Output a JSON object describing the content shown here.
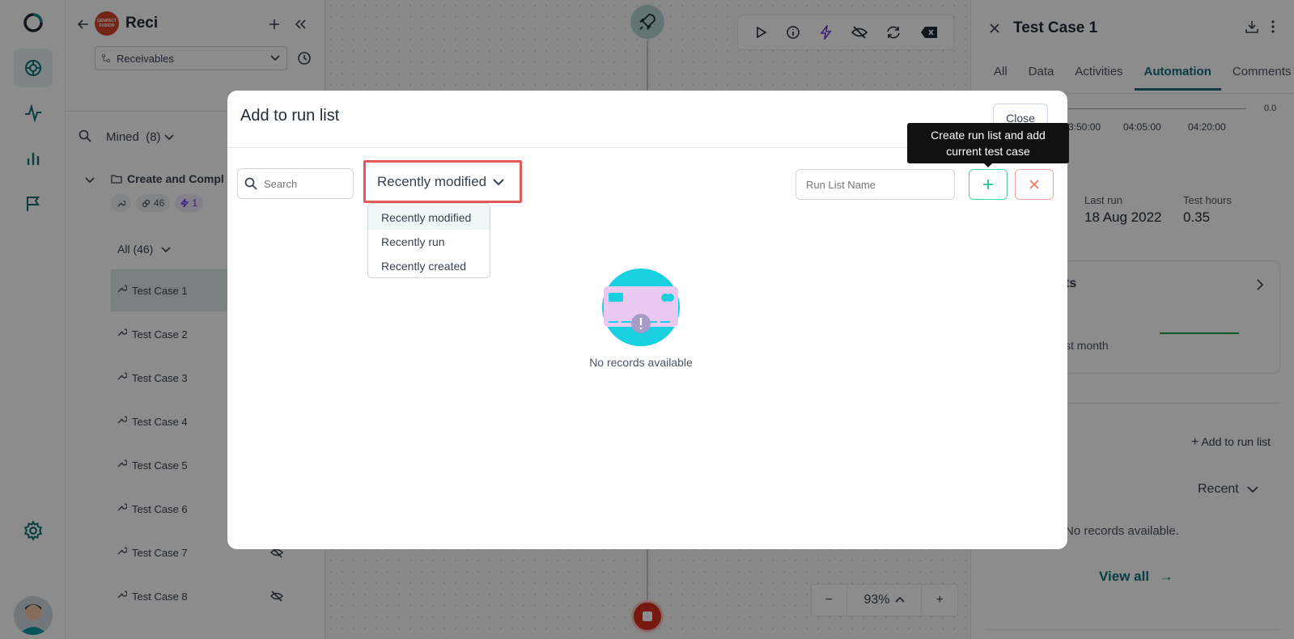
{
  "sidebar": {
    "project_title": "Reci",
    "logo_text": "GENPACT FUSION",
    "project_select": "Receivables",
    "mined_label": "Mined",
    "mined_count": "(8)",
    "folder_name": "Create and Compl",
    "chip_links": "46",
    "chip_auto": "1",
    "all_label": "All (46)",
    "test_cases": [
      "Test Case 1",
      "Test Case 2",
      "Test Case 3",
      "Test Case 4",
      "Test Case 5",
      "Test Case 6",
      "Test Case 7",
      "Test Case 8"
    ]
  },
  "canvas": {
    "zoom_level": "93%",
    "zoom_minus": "−",
    "zoom_plus": "+"
  },
  "right_panel": {
    "title": "Test Case 1",
    "tabs": [
      "All",
      "Data",
      "Activities",
      "Automation",
      "Comments"
    ],
    "active_tab": "Automation",
    "timeline_ticks": [
      "3:50:00",
      "04:05:00",
      "04:20:00"
    ],
    "timeline_top_value": "0.0",
    "last_run_label": "Last run",
    "last_run_value": "18 Aug 2022",
    "test_hours_label": "Test hours",
    "test_hours_value": "0.35",
    "card_title": "ts",
    "card_sub": "st month",
    "add_to_run_list": "Add to run list",
    "recent_label": "Recent",
    "no_records": "No records available.",
    "view_all": "View all"
  },
  "modal": {
    "title": "Add to run list",
    "close_label": "Close",
    "search_placeholder": "Search",
    "sort_selected": "Recently modified",
    "sort_options": [
      "Recently modified",
      "Recently run",
      "Recently created"
    ],
    "run_list_placeholder": "Run List Name",
    "tooltip": "Create run list and add current test case",
    "empty_text": "No records available"
  },
  "colors": {
    "accent": "#0d6e75",
    "highlight_border": "#e05a5a",
    "add_border": "#4fd1a5",
    "cancel_border": "#f5a69b"
  }
}
